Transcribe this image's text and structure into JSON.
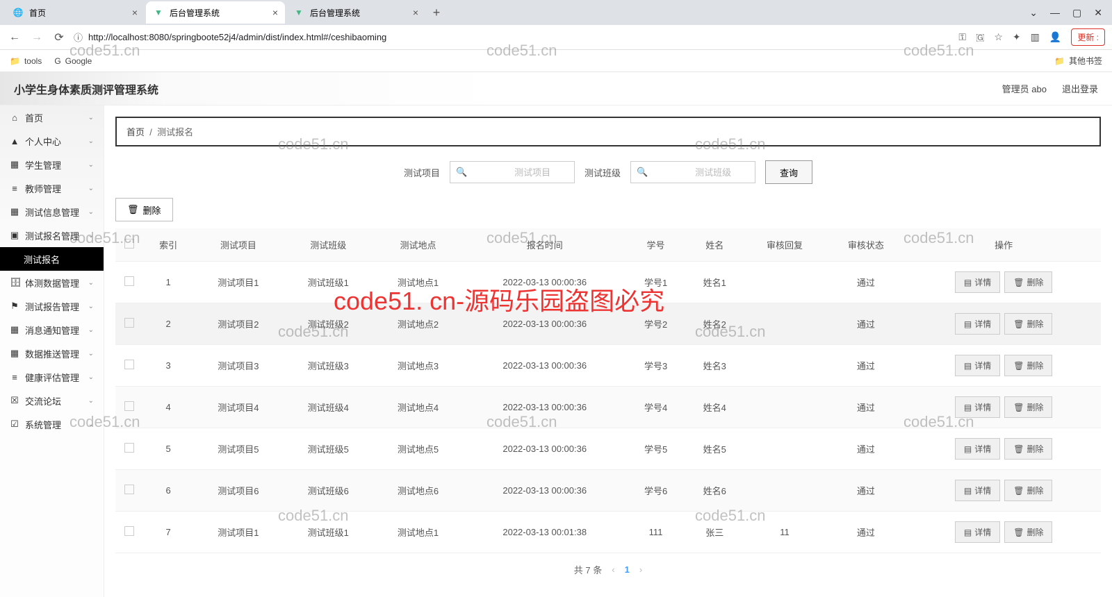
{
  "chrome": {
    "tabs": [
      {
        "title": "首页",
        "active": false
      },
      {
        "title": "后台管理系统",
        "active": true
      },
      {
        "title": "后台管理系统",
        "active": false
      }
    ],
    "url": "http://localhost:8080/springboote52j4/admin/dist/index.html#/ceshibaoming",
    "update": "更新 :",
    "bookmarks": {
      "tools": "tools",
      "google": "Google",
      "other": "其他书签"
    }
  },
  "app": {
    "title": "小学生身体素质测评管理系统",
    "admin_label": "管理员 abo",
    "logout": "退出登录"
  },
  "sidebar": {
    "items": [
      {
        "label": "首页"
      },
      {
        "label": "个人中心"
      },
      {
        "label": "学生管理"
      },
      {
        "label": "教师管理"
      },
      {
        "label": "测试信息管理"
      },
      {
        "label": "测试报名管理"
      },
      {
        "label": "测试报名",
        "sub": true
      },
      {
        "label": "体测数据管理"
      },
      {
        "label": "测试报告管理"
      },
      {
        "label": "消息通知管理"
      },
      {
        "label": "数据推送管理"
      },
      {
        "label": "健康评估管理"
      },
      {
        "label": "交流论坛"
      },
      {
        "label": "系统管理"
      }
    ]
  },
  "breadcrumb": {
    "home": "首页",
    "current": "测试报名"
  },
  "search": {
    "label1": "测试项目",
    "ph1": "测试项目",
    "label2": "测试班级",
    "ph2": "测试班级",
    "query": "查询"
  },
  "buttons": {
    "delete": "删除",
    "detail": "详情"
  },
  "table": {
    "cols": [
      "",
      "索引",
      "测试项目",
      "测试班级",
      "测试地点",
      "报名时间",
      "学号",
      "姓名",
      "审核回复",
      "审核状态",
      "操作"
    ],
    "rows": [
      {
        "idx": "1",
        "proj": "测试项目1",
        "cls": "测试班级1",
        "loc": "测试地点1",
        "time": "2022-03-13 00:00:36",
        "sid": "学号1",
        "name": "姓名1",
        "reply": "",
        "status": "通过"
      },
      {
        "idx": "2",
        "proj": "测试项目2",
        "cls": "测试班级2",
        "loc": "测试地点2",
        "time": "2022-03-13 00:00:36",
        "sid": "学号2",
        "name": "姓名2",
        "reply": "",
        "status": "通过",
        "hl": true
      },
      {
        "idx": "3",
        "proj": "测试项目3",
        "cls": "测试班级3",
        "loc": "测试地点3",
        "time": "2022-03-13 00:00:36",
        "sid": "学号3",
        "name": "姓名3",
        "reply": "",
        "status": "通过"
      },
      {
        "idx": "4",
        "proj": "测试项目4",
        "cls": "测试班级4",
        "loc": "测试地点4",
        "time": "2022-03-13 00:00:36",
        "sid": "学号4",
        "name": "姓名4",
        "reply": "",
        "status": "通过"
      },
      {
        "idx": "5",
        "proj": "测试项目5",
        "cls": "测试班级5",
        "loc": "测试地点5",
        "time": "2022-03-13 00:00:36",
        "sid": "学号5",
        "name": "姓名5",
        "reply": "",
        "status": "通过"
      },
      {
        "idx": "6",
        "proj": "测试项目6",
        "cls": "测试班级6",
        "loc": "测试地点6",
        "time": "2022-03-13 00:00:36",
        "sid": "学号6",
        "name": "姓名6",
        "reply": "",
        "status": "通过"
      },
      {
        "idx": "7",
        "proj": "测试项目1",
        "cls": "测试班级1",
        "loc": "测试地点1",
        "time": "2022-03-13 00:01:38",
        "sid": "111",
        "name": "张三",
        "reply": "11",
        "status": "通过"
      }
    ]
  },
  "pager": {
    "total": "共 7 条",
    "page": "1"
  },
  "watermark": {
    "small": "code51.cn",
    "big": "code51. cn-源码乐园盗图必究"
  }
}
